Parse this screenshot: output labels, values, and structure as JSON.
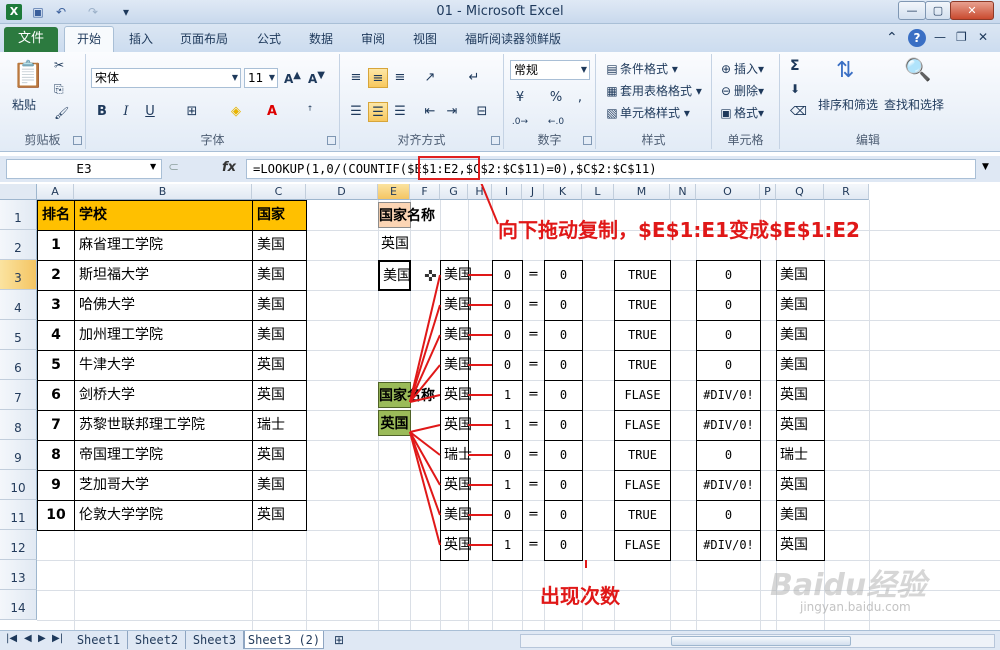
{
  "window": {
    "title": "01 - Microsoft Excel",
    "min": "—",
    "max": "▢",
    "close": "✕"
  },
  "ribbon_tabs": [
    "文件",
    "开始",
    "插入",
    "页面布局",
    "公式",
    "数据",
    "审阅",
    "视图",
    "福昕阅读器领鲜版"
  ],
  "ribbon": {
    "clipboard": {
      "paste": "粘贴",
      "label": "剪贴板"
    },
    "font": {
      "name": "宋体",
      "size": "11",
      "label": "字体",
      "bold": "B",
      "italic": "I",
      "underline": "U"
    },
    "alignment": {
      "label": "对齐方式"
    },
    "number": {
      "format": "常规",
      "label": "数字",
      "percent": "%",
      "comma": ","
    },
    "styles": {
      "conditional": "条件格式",
      "table": "套用表格格式",
      "cell": "单元格样式",
      "label": "样式"
    },
    "cells": {
      "insert": "插入",
      "delete": "删除",
      "format": "格式",
      "label": "单元格"
    },
    "editing": {
      "sum": "Σ",
      "sort": "排序和筛选",
      "find": "查找和选择",
      "label": "编辑"
    }
  },
  "formula_bar": {
    "name_box": "E3",
    "fx": "fx",
    "formula": "=LOOKUP(1,0/(COUNTIF($E$1:E2,$C$2:$C$11)=0),$C$2:$C$11)"
  },
  "columns": [
    "A",
    "B",
    "C",
    "D",
    "E",
    "F",
    "G",
    "H",
    "I",
    "J",
    "K",
    "L",
    "M",
    "N",
    "O",
    "P",
    "Q",
    "R"
  ],
  "rows": [
    "1",
    "2",
    "3",
    "4",
    "5",
    "6",
    "7",
    "8",
    "9",
    "10",
    "11",
    "12",
    "13",
    "14"
  ],
  "table": {
    "headers": [
      "排名",
      "学校",
      "国家"
    ],
    "rows": [
      [
        "1",
        "麻省理工学院",
        "美国"
      ],
      [
        "2",
        "斯坦福大学",
        "美国"
      ],
      [
        "3",
        "哈佛大学",
        "美国"
      ],
      [
        "4",
        "加州理工学院",
        "美国"
      ],
      [
        "5",
        "牛津大学",
        "英国"
      ],
      [
        "6",
        "剑桥大学",
        "英国"
      ],
      [
        "7",
        "苏黎世联邦理工学院",
        "瑞士"
      ],
      [
        "8",
        "帝国理工学院",
        "英国"
      ],
      [
        "9",
        "芝加哥大学",
        "美国"
      ],
      [
        "10",
        "伦敦大学学院",
        "英国"
      ]
    ]
  },
  "country_col": {
    "header": "国家名称",
    "values": [
      "英国",
      "美国"
    ]
  },
  "green_box": {
    "header": "国家名称",
    "value": "英国"
  },
  "calc_rows": [
    {
      "g": "美国",
      "i": "0",
      "eq": "=",
      "k": "0",
      "m": "TRUE",
      "o": "0",
      "q": "美国"
    },
    {
      "g": "美国",
      "i": "0",
      "eq": "=",
      "k": "0",
      "m": "TRUE",
      "o": "0",
      "q": "美国"
    },
    {
      "g": "美国",
      "i": "0",
      "eq": "=",
      "k": "0",
      "m": "TRUE",
      "o": "0",
      "q": "美国"
    },
    {
      "g": "美国",
      "i": "0",
      "eq": "=",
      "k": "0",
      "m": "TRUE",
      "o": "0",
      "q": "美国"
    },
    {
      "g": "英国",
      "i": "1",
      "eq": "=",
      "k": "0",
      "m": "FLASE",
      "o": "#DIV/0!",
      "q": "英国"
    },
    {
      "g": "英国",
      "i": "1",
      "eq": "=",
      "k": "0",
      "m": "FLASE",
      "o": "#DIV/0!",
      "q": "英国"
    },
    {
      "g": "瑞士",
      "i": "0",
      "eq": "=",
      "k": "0",
      "m": "TRUE",
      "o": "0",
      "q": "瑞士"
    },
    {
      "g": "英国",
      "i": "1",
      "eq": "=",
      "k": "0",
      "m": "FLASE",
      "o": "#DIV/0!",
      "q": "英国"
    },
    {
      "g": "美国",
      "i": "0",
      "eq": "=",
      "k": "0",
      "m": "TRUE",
      "o": "0",
      "q": "美国"
    },
    {
      "g": "英国",
      "i": "1",
      "eq": "=",
      "k": "0",
      "m": "FLASE",
      "o": "#DIV/0!",
      "q": "英国"
    }
  ],
  "annotations": {
    "top": "向下拖动复制，$E$1:E1变成$E$1:E2",
    "bottom": "出现次数"
  },
  "sheets": [
    "Sheet1",
    "Sheet2",
    "Sheet3",
    "Sheet3 (2)"
  ],
  "active_sheet": "Sheet3 (2)",
  "watermark": {
    "logo": "Baidu经验",
    "url": "jingyan.baidu.com"
  },
  "colors": {
    "header_fill": "#ffc000",
    "pink_fill": "#fcd5b4",
    "green_fill": "#9bbb59",
    "annotation_red": "#e01818"
  }
}
